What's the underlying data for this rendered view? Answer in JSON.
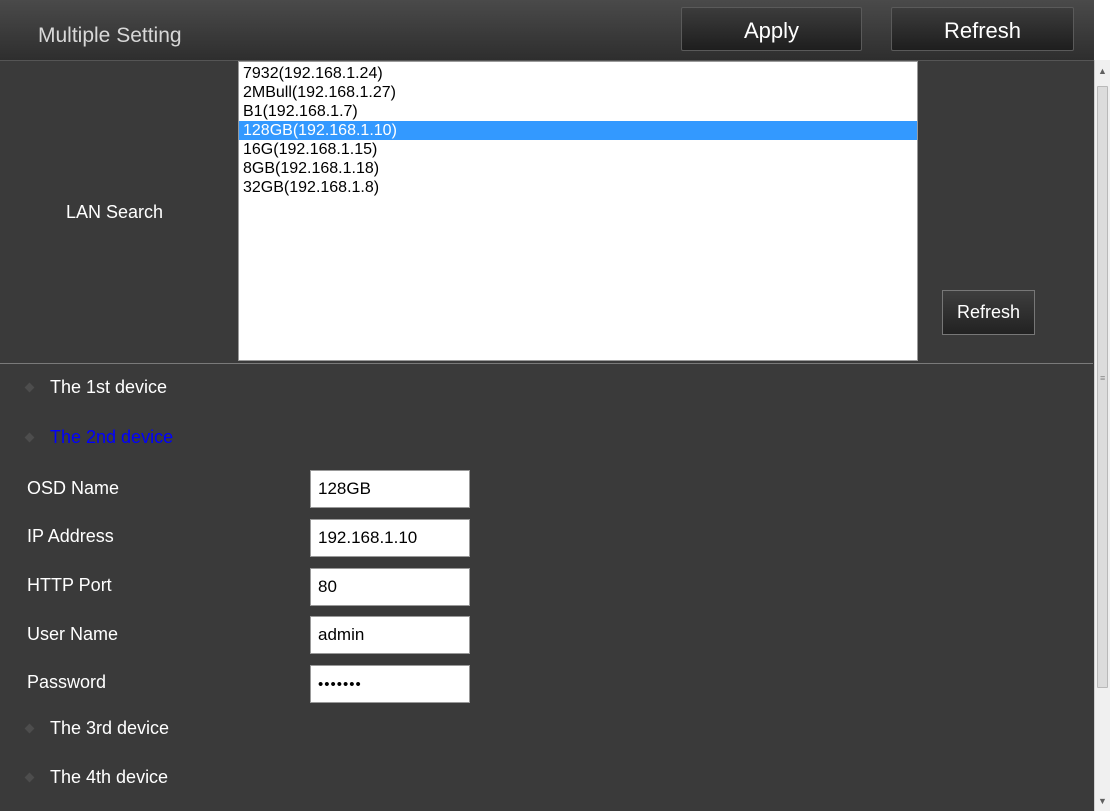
{
  "header": {
    "title": "Multiple Setting",
    "apply_label": "Apply",
    "refresh_label": "Refresh"
  },
  "lan_search": {
    "label": "LAN Search",
    "refresh_label": "Refresh",
    "devices": [
      "7932(192.168.1.24)",
      "2MBull(192.168.1.27)",
      "B1(192.168.1.7)",
      "128GB(192.168.1.10)",
      "16G(192.168.1.15)",
      "8GB(192.168.1.18)",
      "32GB(192.168.1.8)"
    ],
    "selected_index": 3
  },
  "devices": {
    "first": "The 1st device",
    "second": "The 2nd device",
    "third": "The 3rd device",
    "fourth": "The 4th device"
  },
  "form": {
    "osd_name_label": "OSD Name",
    "osd_name_value": "128GB",
    "ip_address_label": "IP Address",
    "ip_address_value": "192.168.1.10",
    "http_port_label": "HTTP Port",
    "http_port_value": "80",
    "user_name_label": "User Name",
    "user_name_value": "admin",
    "password_label": "Password",
    "password_value": "•••••••"
  },
  "colors": {
    "selected_bg": "#3399ff",
    "active_device": "#0000ff",
    "panel_bg": "#3a3a3a"
  }
}
